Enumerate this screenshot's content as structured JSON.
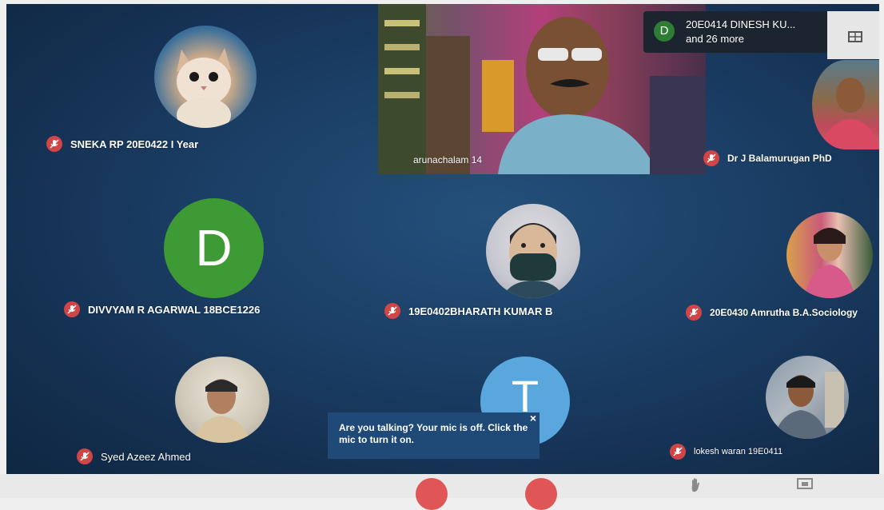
{
  "participants": {
    "sneka": {
      "name": "SNEKA RP 20E0422 I Year"
    },
    "presenter": {
      "name": "arunachalam 14"
    },
    "balamurugan": {
      "name": "Dr J Balamurugan PhD"
    },
    "divvyam": {
      "name": "DIVVYAM R AGARWAL 18BCE1226",
      "initial": "D"
    },
    "bharath": {
      "name": "19E0402BHARATH KUMAR B"
    },
    "amrutha": {
      "name": "20E0430 Amrutha B.A.Sociology"
    },
    "syed": {
      "name": "Syed Azeez Ahmed"
    },
    "t_user": {
      "initial": "T"
    },
    "lokesh": {
      "name": "lokesh waran 19E0411"
    }
  },
  "more_participants": {
    "initial": "D",
    "line1": "20E0414 DINESH KU...",
    "line2": "and 26 more"
  },
  "mic_tooltip": {
    "text": "Are you talking? Your mic is off. Click the mic to turn it on.",
    "close": "×"
  },
  "colors": {
    "background": "#1b3f66",
    "muted_mic": "#d04545",
    "divvyam_avatar": "#3d9a35",
    "t_avatar": "#5aa7de"
  }
}
